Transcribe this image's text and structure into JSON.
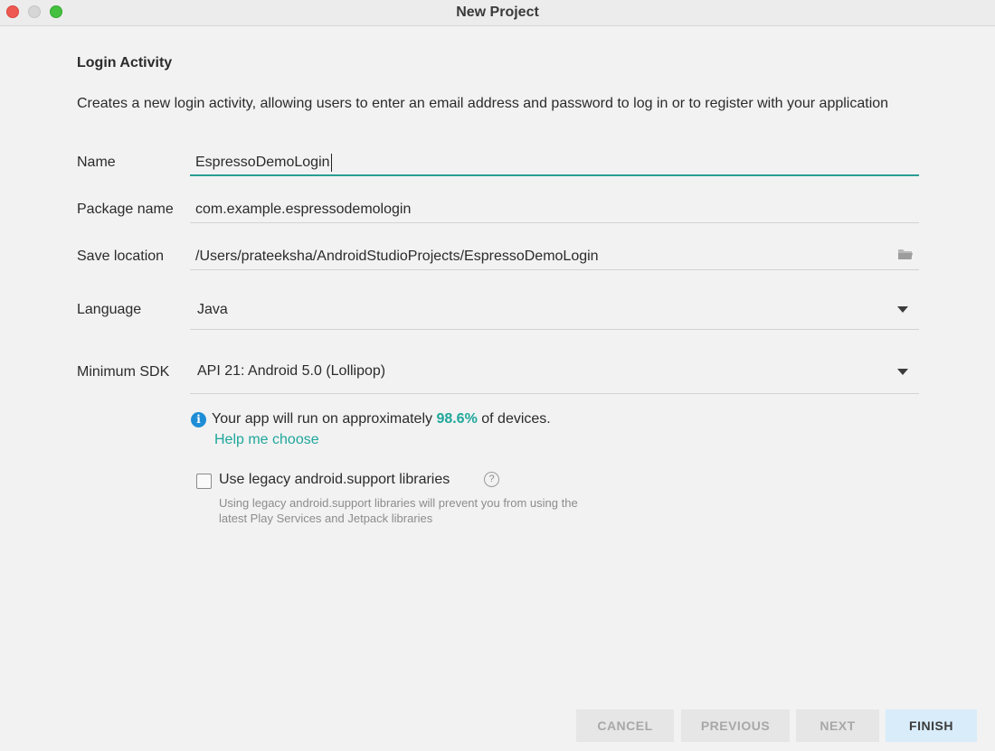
{
  "window": {
    "title": "New Project"
  },
  "section": {
    "title": "Login Activity",
    "description": "Creates a new login activity, allowing users to enter an email address and password to log in or to register with your application"
  },
  "form": {
    "name": {
      "label": "Name",
      "value": "EspressoDemoLogin"
    },
    "package": {
      "label": "Package name",
      "value": "com.example.espressodemologin"
    },
    "save_location": {
      "label": "Save location",
      "value": "/Users/prateeksha/AndroidStudioProjects/EspressoDemoLogin"
    },
    "language": {
      "label": "Language",
      "value": "Java"
    },
    "min_sdk": {
      "label": "Minimum SDK",
      "value": "API 21: Android 5.0 (Lollipop)"
    }
  },
  "info": {
    "prefix": "Your app will run on approximately ",
    "percent": "98.6%",
    "suffix": " of devices.",
    "help_link": "Help me choose"
  },
  "legacy": {
    "label": "Use legacy android.support libraries",
    "checked": false,
    "hint": "Using legacy android.support libraries will prevent you from using the latest Play Services and Jetpack libraries"
  },
  "buttons": {
    "cancel": "CANCEL",
    "previous": "PREVIOUS",
    "next": "NEXT",
    "finish": "FINISH"
  },
  "colors": {
    "accent": "#1fa79b",
    "focus_underline": "#2a9d94",
    "info_icon": "#1f8dd6"
  }
}
